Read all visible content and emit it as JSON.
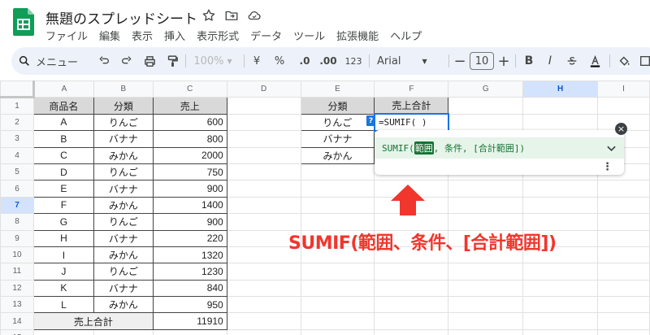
{
  "app": {
    "doc_title": "無題のスプレッドシート",
    "menu": [
      "ファイル",
      "編集",
      "表示",
      "挿入",
      "表示形式",
      "データ",
      "ツール",
      "拡張機能",
      "ヘルプ"
    ],
    "brand_color": "#0f9d58"
  },
  "toolbar": {
    "menu_search_label": "メニュー",
    "zoom": "100%",
    "currency": "¥",
    "percent": "%",
    "dec_decrease": ".0",
    "dec_increase": ".00",
    "number_format": "123",
    "font": "Arial",
    "font_size": "10",
    "bold": "B",
    "italic": "I"
  },
  "grid": {
    "columns": [
      "A",
      "B",
      "C",
      "D",
      "E",
      "F",
      "G",
      "H",
      "I"
    ],
    "rows": [
      "1",
      "2",
      "3",
      "4",
      "5",
      "6",
      "7",
      "8",
      "9",
      "10",
      "11",
      "12",
      "13",
      "14",
      "15"
    ],
    "selected_column": "H",
    "selected_row": "7",
    "table1": {
      "headers": [
        "商品名",
        "分類",
        "売上"
      ],
      "rows": [
        [
          "A",
          "りんご",
          "600"
        ],
        [
          "B",
          "バナナ",
          "800"
        ],
        [
          "C",
          "みかん",
          "2000"
        ],
        [
          "D",
          "りんご",
          "750"
        ],
        [
          "E",
          "バナナ",
          "900"
        ],
        [
          "F",
          "みかん",
          "1400"
        ],
        [
          "G",
          "りんご",
          "900"
        ],
        [
          "H",
          "バナナ",
          "220"
        ],
        [
          "I",
          "みかん",
          "1320"
        ],
        [
          "J",
          "りんご",
          "1230"
        ],
        [
          "K",
          "バナナ",
          "840"
        ],
        [
          "L",
          "みかん",
          "950"
        ]
      ],
      "total_label": "売上合計",
      "total_value": "11910"
    },
    "table2": {
      "headers": [
        "分類",
        "売上合計"
      ],
      "categories": [
        "りんご",
        "バナナ",
        "みかん"
      ],
      "active_formula": "=SUMIF( )"
    }
  },
  "formula_help": {
    "marker": "?",
    "func": "SUMIF(",
    "arg_active": "範囲",
    "rest": ", 条件, [合計範囲])",
    "highlight_color": "#137333"
  },
  "annotation": {
    "text": "SUMIF(範囲、条件、[合計範囲])",
    "color": "#f0362d"
  }
}
